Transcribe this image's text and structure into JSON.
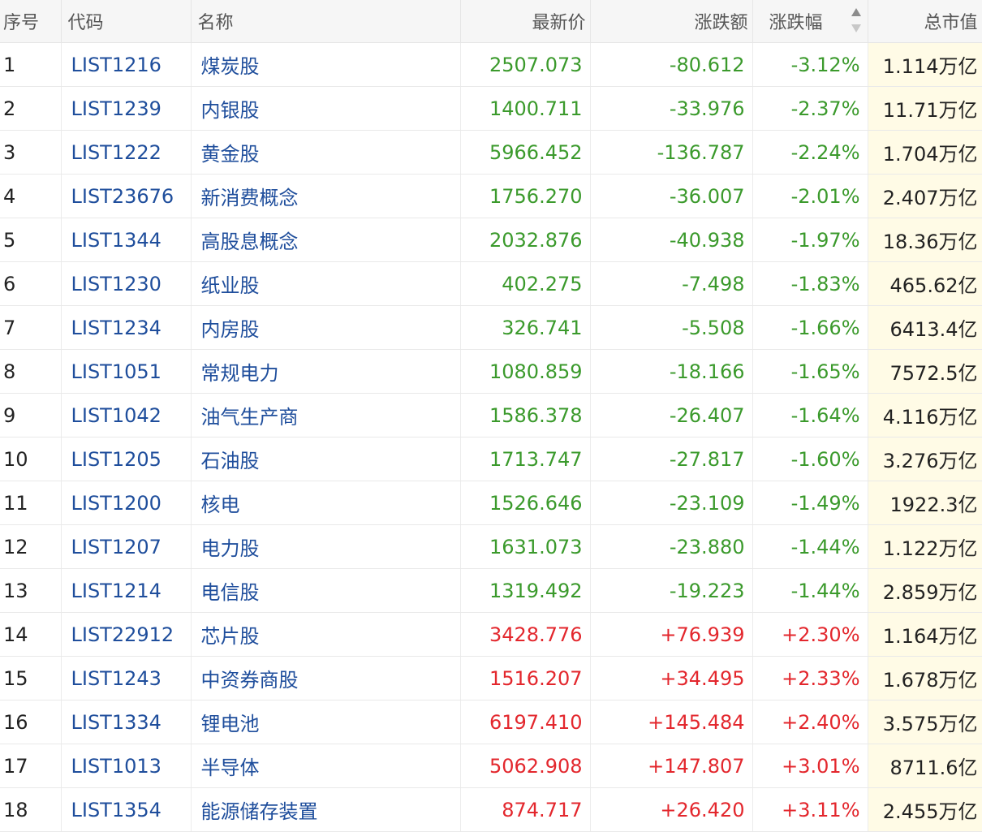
{
  "colors": {
    "up": "#e3272d",
    "down": "#3b9a2c",
    "link": "#1f4e9c",
    "highlight": "#fffbe6"
  },
  "headers": {
    "index": "序号",
    "code": "代码",
    "name": "名称",
    "price": "最新价",
    "change": "涨跌额",
    "pct": "涨跌幅",
    "cap": "总市值"
  },
  "sort": {
    "column": "pct",
    "icon": "sort-toggle-icon",
    "direction": "ascending"
  },
  "rows": [
    {
      "index": "1",
      "code": "LIST1216",
      "name": "煤炭股",
      "price": "2507.073",
      "change": "-80.612",
      "pct": "-3.12%",
      "cap": "1.114万亿",
      "trend": "down"
    },
    {
      "index": "2",
      "code": "LIST1239",
      "name": "内银股",
      "price": "1400.711",
      "change": "-33.976",
      "pct": "-2.37%",
      "cap": "11.71万亿",
      "trend": "down"
    },
    {
      "index": "3",
      "code": "LIST1222",
      "name": "黄金股",
      "price": "5966.452",
      "change": "-136.787",
      "pct": "-2.24%",
      "cap": "1.704万亿",
      "trend": "down"
    },
    {
      "index": "4",
      "code": "LIST23676",
      "name": "新消费概念",
      "price": "1756.270",
      "change": "-36.007",
      "pct": "-2.01%",
      "cap": "2.407万亿",
      "trend": "down"
    },
    {
      "index": "5",
      "code": "LIST1344",
      "name": "高股息概念",
      "price": "2032.876",
      "change": "-40.938",
      "pct": "-1.97%",
      "cap": "18.36万亿",
      "trend": "down"
    },
    {
      "index": "6",
      "code": "LIST1230",
      "name": "纸业股",
      "price": "402.275",
      "change": "-7.498",
      "pct": "-1.83%",
      "cap": "465.62亿",
      "trend": "down"
    },
    {
      "index": "7",
      "code": "LIST1234",
      "name": "内房股",
      "price": "326.741",
      "change": "-5.508",
      "pct": "-1.66%",
      "cap": "6413.4亿",
      "trend": "down"
    },
    {
      "index": "8",
      "code": "LIST1051",
      "name": "常规电力",
      "price": "1080.859",
      "change": "-18.166",
      "pct": "-1.65%",
      "cap": "7572.5亿",
      "trend": "down"
    },
    {
      "index": "9",
      "code": "LIST1042",
      "name": "油气生产商",
      "price": "1586.378",
      "change": "-26.407",
      "pct": "-1.64%",
      "cap": "4.116万亿",
      "trend": "down"
    },
    {
      "index": "10",
      "code": "LIST1205",
      "name": "石油股",
      "price": "1713.747",
      "change": "-27.817",
      "pct": "-1.60%",
      "cap": "3.276万亿",
      "trend": "down"
    },
    {
      "index": "11",
      "code": "LIST1200",
      "name": "核电",
      "price": "1526.646",
      "change": "-23.109",
      "pct": "-1.49%",
      "cap": "1922.3亿",
      "trend": "down"
    },
    {
      "index": "12",
      "code": "LIST1207",
      "name": "电力股",
      "price": "1631.073",
      "change": "-23.880",
      "pct": "-1.44%",
      "cap": "1.122万亿",
      "trend": "down"
    },
    {
      "index": "13",
      "code": "LIST1214",
      "name": "电信股",
      "price": "1319.492",
      "change": "-19.223",
      "pct": "-1.44%",
      "cap": "2.859万亿",
      "trend": "down"
    },
    {
      "index": "14",
      "code": "LIST22912",
      "name": "芯片股",
      "price": "3428.776",
      "change": "+76.939",
      "pct": "+2.30%",
      "cap": "1.164万亿",
      "trend": "up"
    },
    {
      "index": "15",
      "code": "LIST1243",
      "name": "中资券商股",
      "price": "1516.207",
      "change": "+34.495",
      "pct": "+2.33%",
      "cap": "1.678万亿",
      "trend": "up"
    },
    {
      "index": "16",
      "code": "LIST1334",
      "name": "锂电池",
      "price": "6197.410",
      "change": "+145.484",
      "pct": "+2.40%",
      "cap": "3.575万亿",
      "trend": "up"
    },
    {
      "index": "17",
      "code": "LIST1013",
      "name": "半导体",
      "price": "5062.908",
      "change": "+147.807",
      "pct": "+3.01%",
      "cap": "8711.6亿",
      "trend": "up"
    },
    {
      "index": "18",
      "code": "LIST1354",
      "name": "能源储存装置",
      "price": "874.717",
      "change": "+26.420",
      "pct": "+3.11%",
      "cap": "2.455万亿",
      "trend": "up"
    }
  ]
}
